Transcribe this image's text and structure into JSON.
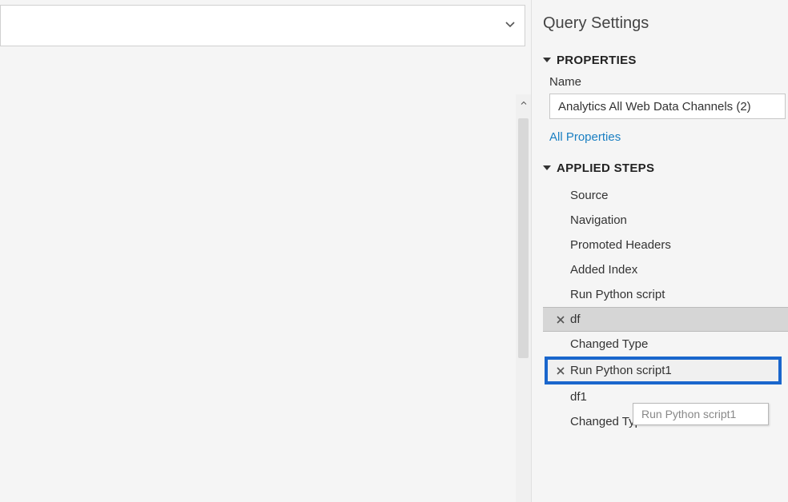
{
  "panel": {
    "title": "Query Settings"
  },
  "properties": {
    "header": "PROPERTIES",
    "name_label": "Name",
    "name_value": "Analytics All Web Data Channels (2)",
    "all_properties_link": "All Properties"
  },
  "applied_steps": {
    "header": "APPLIED STEPS",
    "items": [
      {
        "label": "Source"
      },
      {
        "label": "Navigation"
      },
      {
        "label": "Promoted Headers"
      },
      {
        "label": "Added Index"
      },
      {
        "label": "Run Python script"
      },
      {
        "label": "df"
      },
      {
        "label": "Changed Type"
      },
      {
        "label": "Run Python script1"
      },
      {
        "label": "df1"
      },
      {
        "label": "Changed Type1"
      }
    ]
  },
  "tooltip": "Run Python script1"
}
